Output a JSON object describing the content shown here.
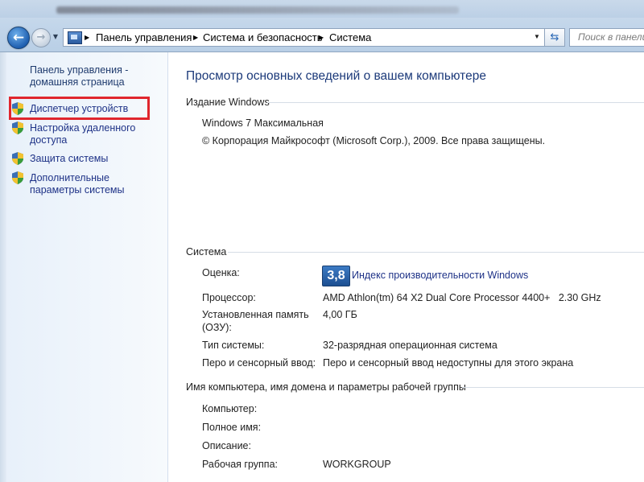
{
  "address_bar": {
    "crumbs": [
      "Панель управления",
      "Система и безопасность",
      "Система"
    ]
  },
  "search": {
    "placeholder": "Поиск в панели"
  },
  "icons": {
    "back": "back-arrow-icon",
    "forward": "forward-arrow-icon",
    "location": "control-panel-icon",
    "refresh": "refresh-icon",
    "shield": "uac-shield-icon"
  },
  "sidebar": {
    "home": "Панель управления - домашняя страница",
    "items": [
      {
        "label": "Диспетчер устройств",
        "highlighted": true
      },
      {
        "label": "Настройка удаленного доступа"
      },
      {
        "label": "Защита системы"
      },
      {
        "label": "Дополнительные параметры системы"
      }
    ]
  },
  "main": {
    "title": "Просмотр основных сведений о вашем компьютере",
    "edition_section": {
      "heading": "Издание Windows",
      "edition": "Windows 7 Максимальная",
      "copyright": "© Корпорация Майкрософт (Microsoft Corp.), 2009. Все права защищены."
    },
    "system_section": {
      "heading": "Система",
      "rating_label": "Оценка:",
      "rating_value": "3,8",
      "rating_link": "Индекс производительности Windows",
      "processor_label": "Процессор:",
      "processor_value": "AMD Athlon(tm) 64 X2 Dual Core Processor 4400+   2.30 GHz",
      "memory_label_1": "Установленная память",
      "memory_label_2": "(ОЗУ):",
      "memory_value": "4,00 ГБ",
      "system_type_label": "Тип системы:",
      "system_type_value": "32-разрядная операционная система",
      "pen_label": "Перо и сенсорный ввод:",
      "pen_value": "Перо и сенсорный ввод недоступны для этого экрана"
    },
    "computer_section": {
      "heading": "Имя компьютера, имя домена и параметры рабочей группы",
      "computer_label": "Компьютер:",
      "fullname_label": "Полное имя:",
      "description_label": "Описание:",
      "workgroup_label": "Рабочая группа:",
      "workgroup_value": "WORKGROUP"
    }
  }
}
